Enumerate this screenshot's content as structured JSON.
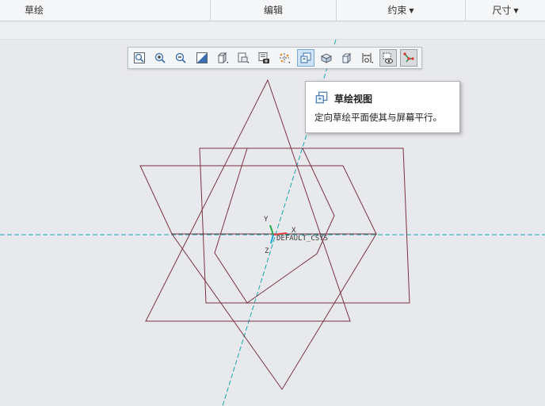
{
  "ribbon": {
    "groups": [
      {
        "label": "草绘"
      },
      {
        "label": "编辑"
      },
      {
        "label": "约束",
        "dropdown": true
      },
      {
        "label": "尺寸",
        "dropdown": true
      }
    ]
  },
  "toolbar": {
    "buttons": [
      {
        "name": "refit"
      },
      {
        "name": "zoom-in"
      },
      {
        "name": "zoom-out"
      },
      {
        "name": "repaint"
      },
      {
        "name": "display-style",
        "has_menu": true
      },
      {
        "name": "saved-orientations",
        "has_menu": true
      },
      {
        "name": "view-manager"
      },
      {
        "name": "datum-display-filters",
        "has_menu": true
      },
      {
        "name": "sketch-view",
        "state": "active"
      },
      {
        "name": "spin-center"
      },
      {
        "name": "annotation-display"
      },
      {
        "name": "dimension-display",
        "has_menu": true
      },
      {
        "name": "disp-constraints",
        "state": "pressed"
      },
      {
        "name": "disp-vertices",
        "state": "pressed"
      }
    ]
  },
  "tooltip": {
    "title": "草绘视图",
    "description": "定向草绘平面使其与屏幕平行。"
  },
  "csys": {
    "name": "DEFAULT_CSYS",
    "x_label": "X",
    "y_label": "Y",
    "z_label": "Z"
  },
  "colors": {
    "background": "#e8e9ec",
    "sketch_lines": "#7a3442",
    "centerline": "#18a6b0",
    "tooltip_border": "#a9adb3",
    "active_button": "#cfe3f7"
  }
}
